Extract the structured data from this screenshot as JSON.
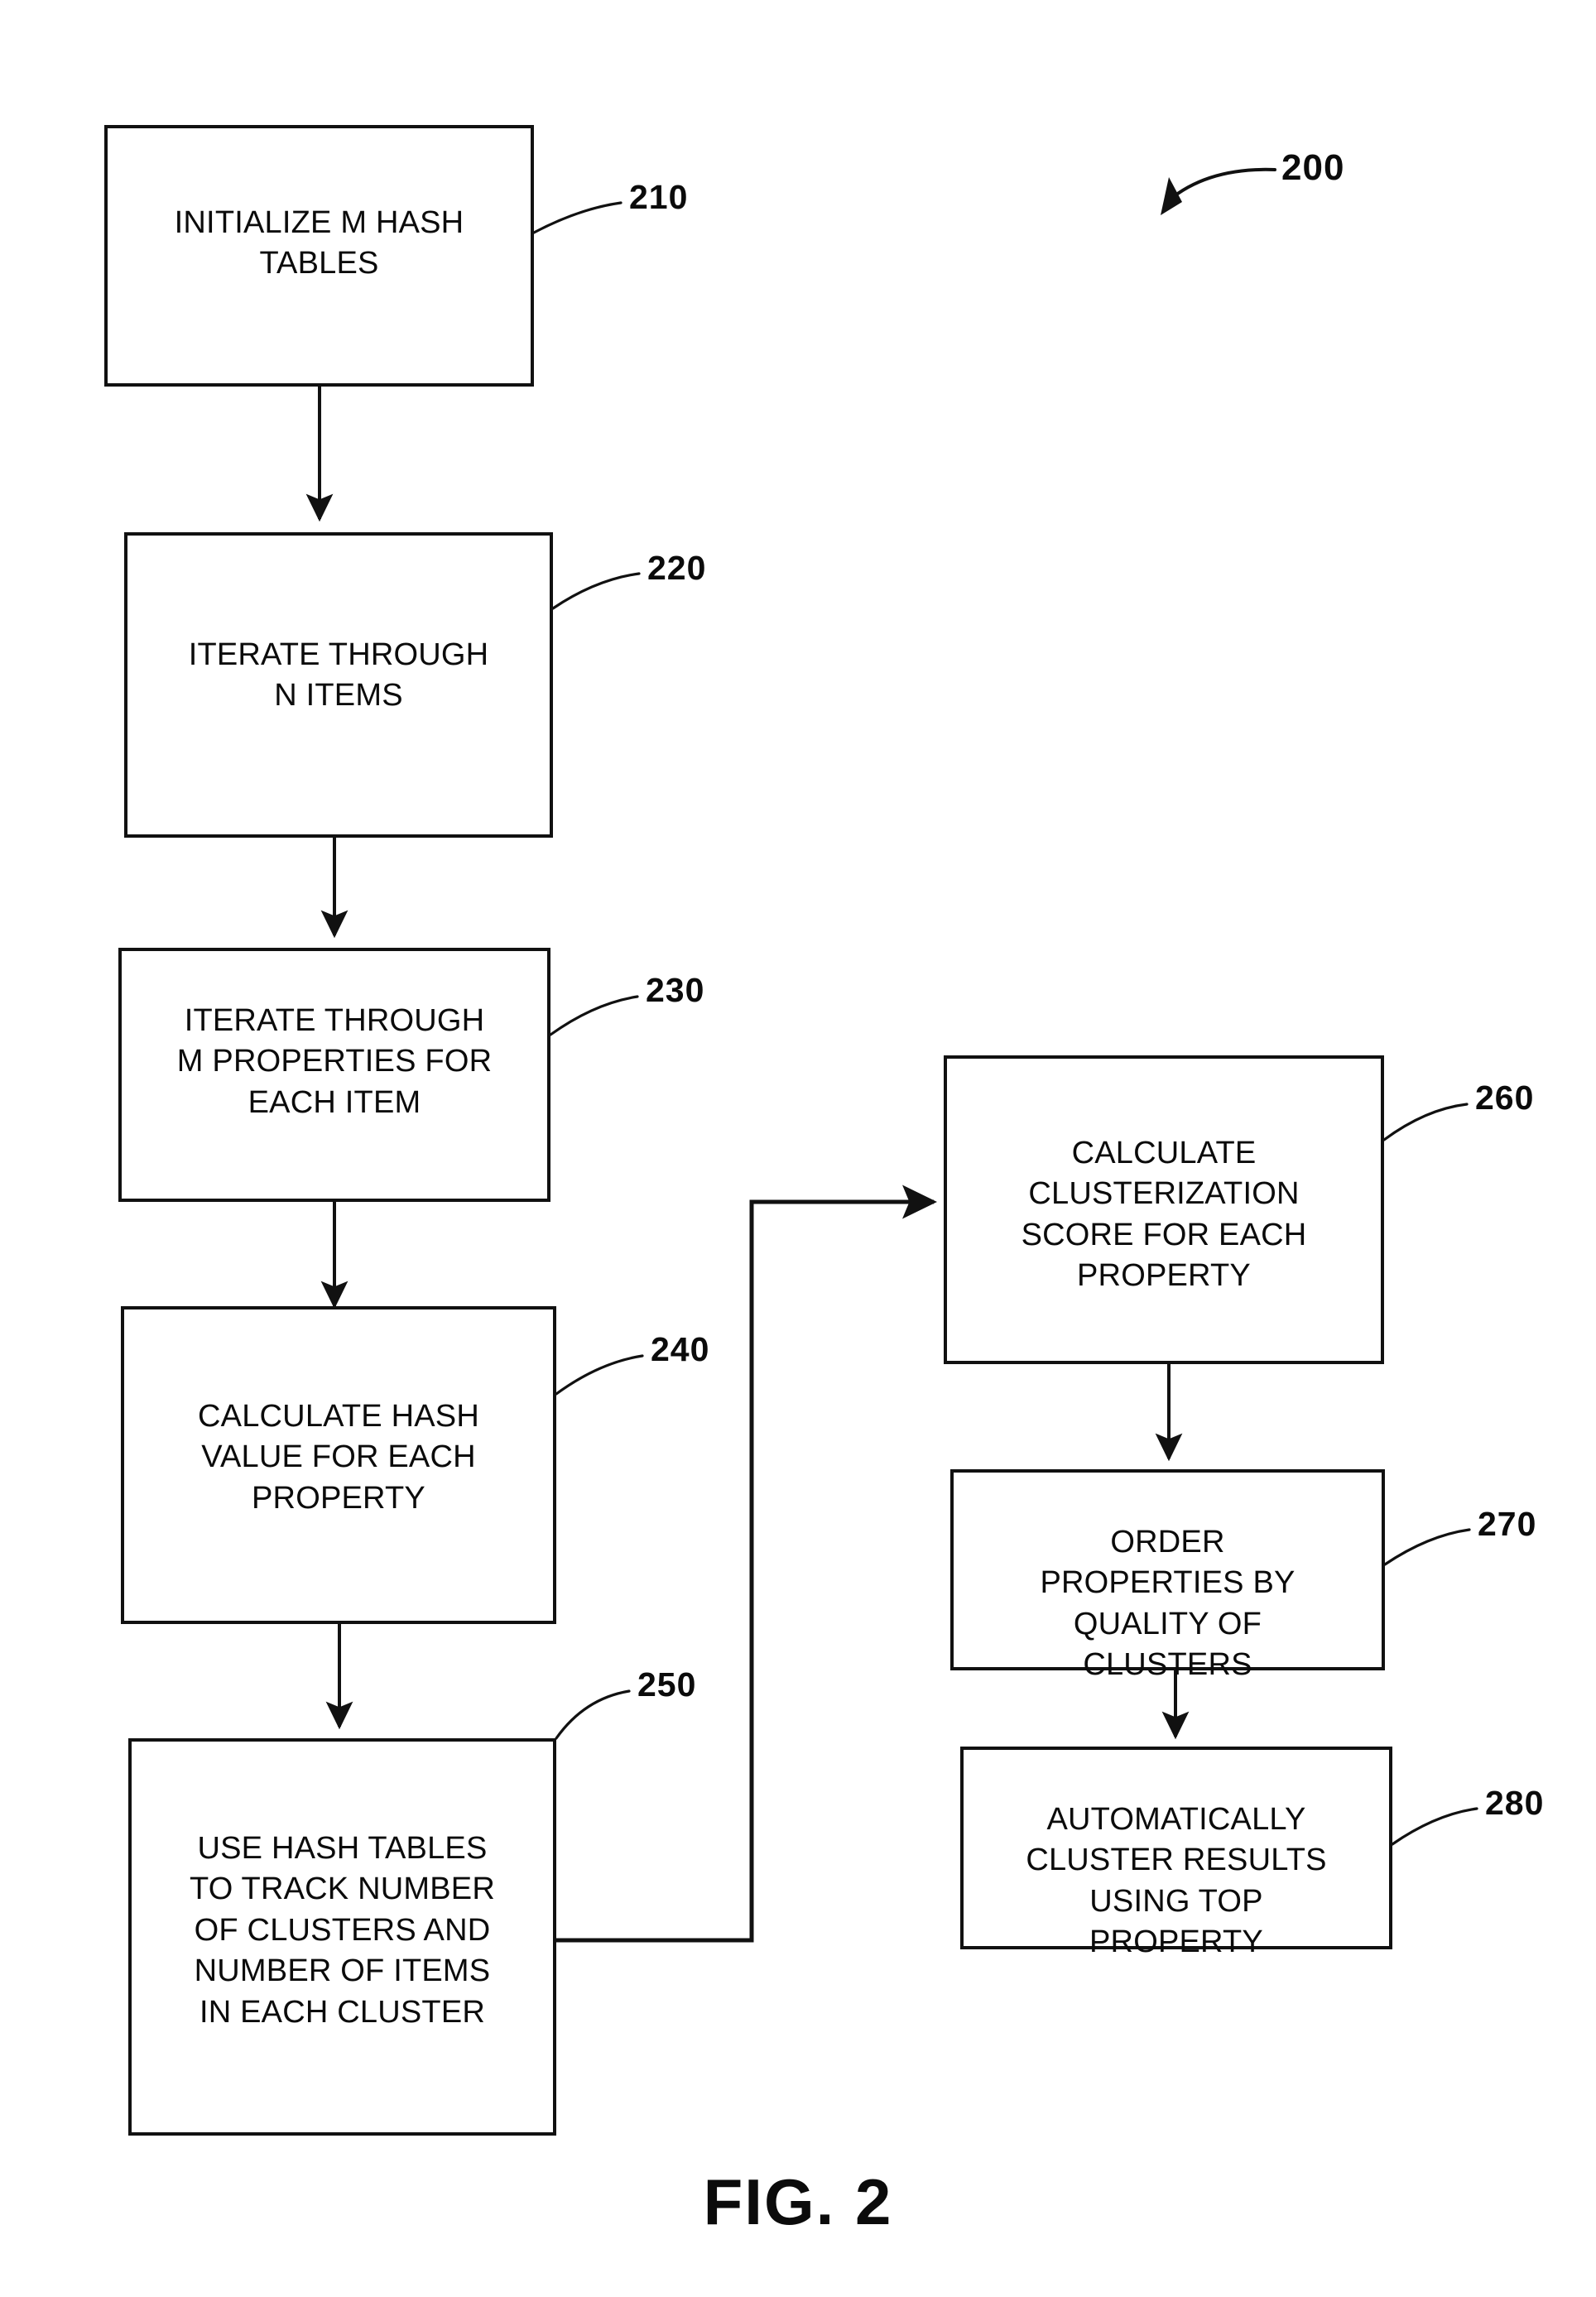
{
  "figure": {
    "caption": "FIG. 2",
    "diagram_ref": "200"
  },
  "diagram": {
    "type": "flowchart",
    "orientation": "two-column, top-to-bottom",
    "nodes": [
      {
        "ref": "210",
        "text": "INITIALIZE M HASH\nTABLES",
        "column": "left",
        "order": 1
      },
      {
        "ref": "220",
        "text": "ITERATE THROUGH\nN ITEMS",
        "column": "left",
        "order": 2
      },
      {
        "ref": "230",
        "text": "ITERATE THROUGH\nM PROPERTIES FOR\nEACH ITEM",
        "column": "left",
        "order": 3
      },
      {
        "ref": "240",
        "text": "CALCULATE HASH\nVALUE FOR EACH\nPROPERTY",
        "column": "left",
        "order": 4
      },
      {
        "ref": "250",
        "text": "USE HASH TABLES\nTO TRACK NUMBER\nOF CLUSTERS AND\nNUMBER OF ITEMS\nIN EACH CLUSTER",
        "column": "left",
        "order": 5
      },
      {
        "ref": "260",
        "text": "CALCULATE\nCLUSTERIZATION\nSCORE FOR EACH\nPROPERTY",
        "column": "right",
        "order": 6
      },
      {
        "ref": "270",
        "text": "ORDER\nPROPERTIES BY\nQUALITY OF\nCLUSTERS",
        "column": "right",
        "order": 7
      },
      {
        "ref": "280",
        "text": "AUTOMATICALLY\nCLUSTER RESULTS\nUSING TOP\nPROPERTY",
        "column": "right",
        "order": 8
      }
    ],
    "edges": [
      {
        "from": "210",
        "to": "220",
        "style": "straight-down-arrow"
      },
      {
        "from": "220",
        "to": "230",
        "style": "straight-down-arrow"
      },
      {
        "from": "230",
        "to": "240",
        "style": "straight-down-arrow"
      },
      {
        "from": "240",
        "to": "250",
        "style": "straight-down-arrow"
      },
      {
        "from": "250",
        "to": "260",
        "style": "orthogonal-right-up-right-arrow"
      },
      {
        "from": "260",
        "to": "270",
        "style": "straight-down-arrow"
      },
      {
        "from": "270",
        "to": "280",
        "style": "straight-down-arrow"
      }
    ]
  },
  "colors": {
    "ink": "#0b0b0b",
    "line": "#111111",
    "background": "#ffffff"
  }
}
